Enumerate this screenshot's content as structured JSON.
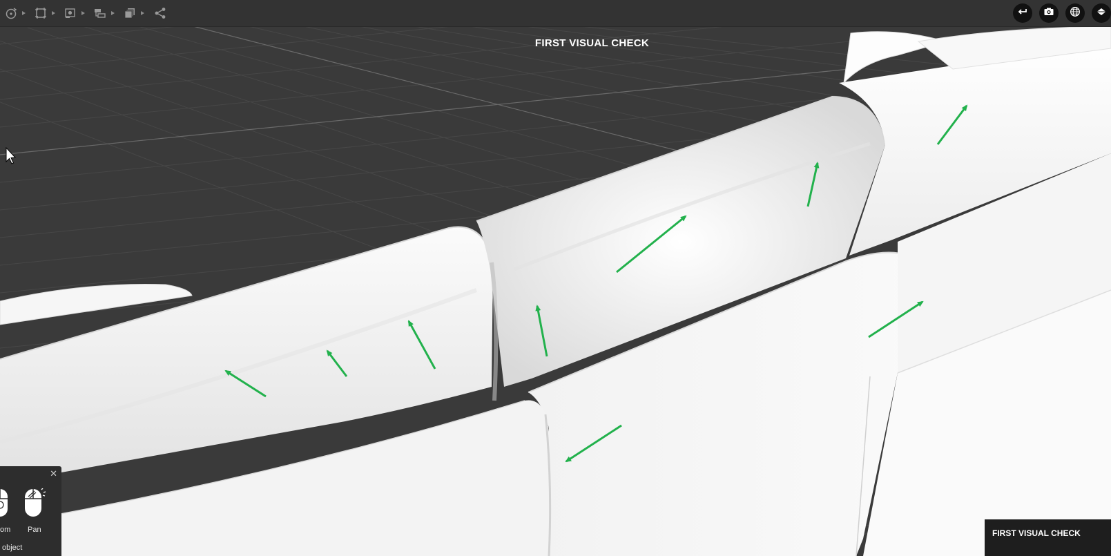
{
  "scene": {
    "title": "FIRST VISUAL CHECK"
  },
  "toolbar": {
    "left_tools": [
      {
        "name": "orbit-tool",
        "icon": "orbit-icon",
        "has_menu": true
      },
      {
        "name": "frame-tool",
        "icon": "frame-icon",
        "has_menu": true
      },
      {
        "name": "camera-tool",
        "icon": "camera-view-icon",
        "has_menu": true
      },
      {
        "name": "hierarchy-tool",
        "icon": "hierarchy-icon",
        "has_menu": true
      },
      {
        "name": "layers-tool",
        "icon": "layers-icon",
        "has_menu": true
      },
      {
        "name": "share-tool",
        "icon": "share-icon",
        "has_menu": false
      }
    ],
    "right_buttons": [
      {
        "name": "undo-button",
        "icon": "undo-icon"
      },
      {
        "name": "screenshot-button",
        "icon": "camera-icon"
      },
      {
        "name": "environment-button",
        "icon": "globe-icon"
      },
      {
        "name": "view-mode-button",
        "icon": "ground-plane-icon"
      }
    ]
  },
  "help_panel": {
    "zoom_label": "om",
    "pan_label": "Pan",
    "object_label": "object",
    "close_icon": "close-icon"
  },
  "status_box": {
    "label": "FIRST VISUAL CHECK"
  },
  "colors": {
    "toolbar_bg": "#333333",
    "viewport_bg": "#3a3a3a",
    "grid_line": "#4a4a4a",
    "arrow_green": "#22b14c",
    "model_white": "#f4f4f4"
  }
}
